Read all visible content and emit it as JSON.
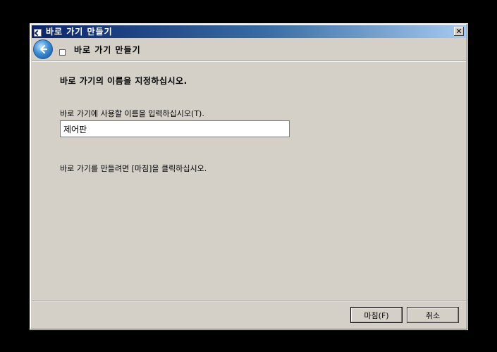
{
  "window": {
    "title": "바로 가기 만들기",
    "close_label": "✕"
  },
  "header": {
    "title": "바로 가기 만들기"
  },
  "content": {
    "heading": "바로 가기의 이름을 지정하십시오.",
    "input_label": "바로 가기에 사용할 이름을 입력하십시오(T).",
    "input_value": "제어판",
    "finish_hint": "바로 가기를 만들려면 [마침]을 클릭하십시오."
  },
  "buttons": {
    "finish": "마침(F)",
    "cancel": "취소"
  },
  "colors": {
    "titlebar_start": "#0a246a",
    "titlebar_end": "#a6caf0",
    "dialog_bg": "#d4d0c8"
  }
}
